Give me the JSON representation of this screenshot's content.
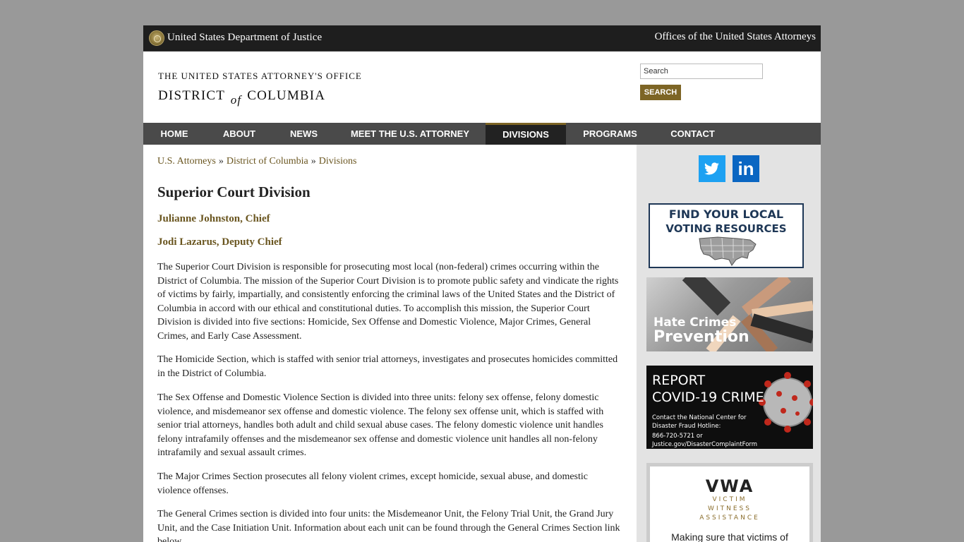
{
  "topbar": {
    "doj_name": "United States Department of Justice",
    "usao_link": "Offices of the United States Attorneys"
  },
  "header": {
    "office_line": "THE UNITED STATES ATTORNEY'S OFFICE",
    "district_left": "DISTRICT",
    "district_of": "of",
    "district_right": "COLUMBIA",
    "search_placeholder": "Search",
    "search_button": "SEARCH"
  },
  "nav": {
    "items": [
      {
        "label": "HOME"
      },
      {
        "label": "ABOUT"
      },
      {
        "label": "NEWS"
      },
      {
        "label": "MEET THE U.S. ATTORNEY"
      },
      {
        "label": "DIVISIONS"
      },
      {
        "label": "PROGRAMS"
      },
      {
        "label": "CONTACT"
      }
    ],
    "active": "DIVISIONS",
    "accent_color": "#7d6525"
  },
  "breadcrumb": [
    "U.S. Attorneys",
    "District of Columbia",
    "Divisions"
  ],
  "breadcrumb_separator": "»",
  "main": {
    "title": "Superior Court Division",
    "chief": "Julianne Johnston, Chief",
    "deputy_chief": "Jodi Lazarus, Deputy Chief",
    "paragraphs": [
      "The Superior Court Division is responsible for prosecuting most local (non-federal) crimes occurring within the District of Columbia. The mission of the Superior Court Division is to promote public safety and vindicate the rights of victims by fairly, impartially, and consistently enforcing the criminal laws of the United States and the District of Columbia in accord with our ethical and constitutional duties. To accomplish this mission, the Superior Court Division is divided into five sections: Homicide, Sex Offense and Domestic Violence, Major Crimes, General Crimes, and Early Case Assessment.",
      "The Homicide Section, which is staffed with senior trial attorneys, investigates and prosecutes homicides committed in the District of Columbia.",
      "The Sex Offense and Domestic Violence Section is divided into three units: felony sex offense, felony domestic violence, and misdemeanor sex offense and domestic violence. The felony sex offense unit, which is staffed with senior trial attorneys, handles both adult and child sexual abuse cases. The felony domestic violence unit handles felony intrafamily offenses and the misdemeanor sex offense and domestic violence unit handles all non-felony intrafamily and sexual assault crimes.",
      "The Major Crimes Section prosecutes all felony violent crimes, except homicide, sexual abuse, and domestic violence offenses.",
      "The General Crimes section is divided into four units: the Misdemeanor Unit, the Felony Trial Unit, the Grand Jury Unit, and the Case Initiation Unit. Information about each unit can be found through the General Crimes Section link below."
    ]
  },
  "sidebar": {
    "social": [
      {
        "icon": "twitter-icon",
        "color": "#1da1f2"
      },
      {
        "icon": "linkedin-icon",
        "label": "in",
        "color": "#0a66c2"
      }
    ],
    "voting": {
      "line1": "FIND YOUR LOCAL",
      "line2": "VOTING RESOURCES"
    },
    "hate_crimes": {
      "line1": "Hate Crimes",
      "line2": "Prevention"
    },
    "covid": {
      "line1": "REPORT",
      "line2": "COVID-19 CRIME",
      "small": [
        "Contact the National Center for",
        "Disaster Fraud Hotline:",
        "866-720-5721 or",
        "Justice.gov/DisasterComplaintForm"
      ]
    },
    "vwa": {
      "logo": "VWA",
      "sub": [
        "VICTIM",
        "WITNESS",
        "ASSISTANCE"
      ],
      "text": "Making sure that victims of"
    }
  }
}
